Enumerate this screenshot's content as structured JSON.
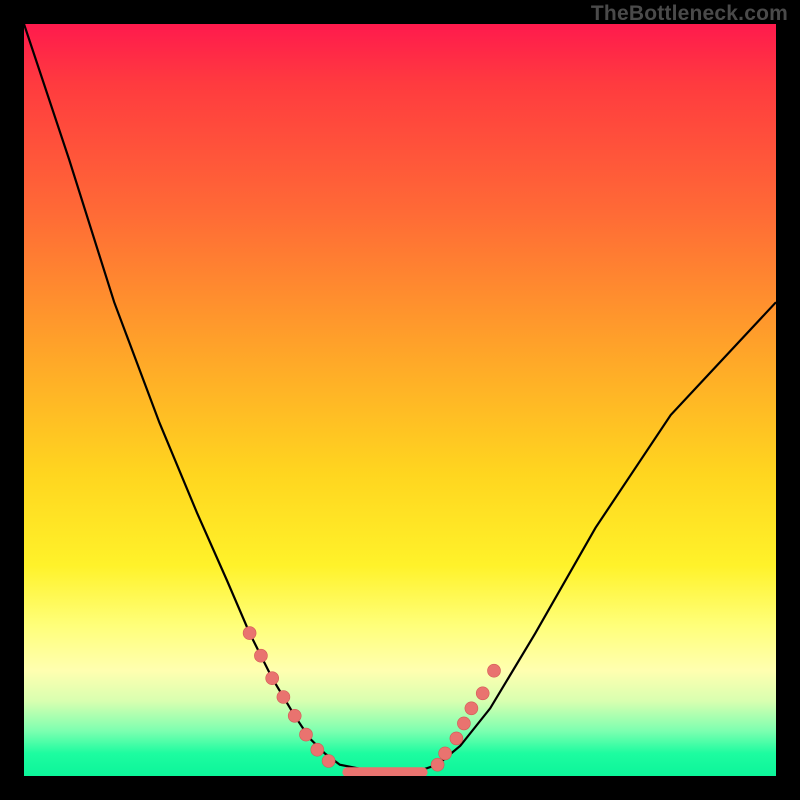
{
  "watermark": "TheBottleneck.com",
  "chart_data": {
    "type": "line",
    "title": "",
    "xlabel": "",
    "ylabel": "",
    "xlim": [
      0,
      100
    ],
    "ylim": [
      0,
      100
    ],
    "grid": false,
    "series": [
      {
        "name": "curve",
        "x": [
          0,
          6,
          12,
          18,
          23,
          27,
          30,
          33,
          36,
          38,
          40,
          42,
          47,
          52,
          55,
          58,
          62,
          68,
          76,
          86,
          100
        ],
        "y": [
          100,
          82,
          63,
          47,
          35,
          26,
          19,
          13,
          8,
          5,
          3,
          1.5,
          0.5,
          0.5,
          1.5,
          4,
          9,
          19,
          33,
          48,
          63
        ]
      }
    ],
    "markers": {
      "left_cluster": {
        "x": [
          30,
          31.5,
          33,
          34.5,
          36,
          37.5,
          39,
          40.5
        ],
        "y": [
          19,
          16,
          13,
          10.5,
          8,
          5.5,
          3.5,
          2
        ]
      },
      "right_cluster": {
        "x": [
          55,
          56,
          57.5,
          58.5,
          59.5,
          61,
          62.5
        ],
        "y": [
          1.5,
          3,
          5,
          7,
          9,
          11,
          14
        ]
      },
      "flat_segment": {
        "x0": 43,
        "x1": 53,
        "y": 0.5
      }
    },
    "background_gradient": {
      "top": "#ff1a4d",
      "mid": "#ffd61f",
      "bottom": "#0cf59a"
    }
  }
}
